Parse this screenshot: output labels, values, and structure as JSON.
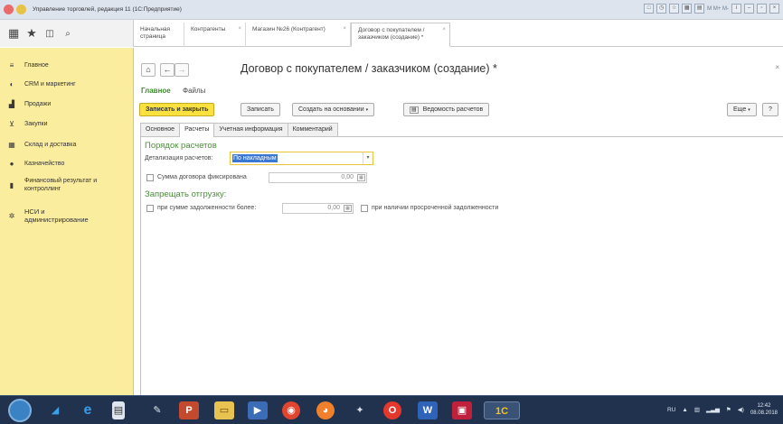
{
  "window": {
    "title": "Управление торговлей, редакция 11 (1С:Предприятие)",
    "right_text": "M  M+  M-"
  },
  "top_tabs": [
    {
      "label": "Начальная страница"
    },
    {
      "label": "Контрагенты"
    },
    {
      "label": "Магазин №26 (Контрагент)"
    },
    {
      "label1": "Договор с покупателем /",
      "label2": "заказчиком (создание) *"
    }
  ],
  "sidebar": {
    "items": [
      {
        "label": "Главное"
      },
      {
        "label": "CRM и маркетинг"
      },
      {
        "label": "Продажи"
      },
      {
        "label": "Закупки"
      },
      {
        "label": "Склад и доставка"
      },
      {
        "label": "Казначейство"
      },
      {
        "label1": "Финансовый результат и",
        "label2": "контроллинг"
      },
      {
        "label1": "НСИ и",
        "label2": "администрирование"
      }
    ]
  },
  "form": {
    "title": "Договор с покупателем / заказчиком (создание) *",
    "section_main": "Главное",
    "section_files": "Файлы",
    "buttons": {
      "save_close": "Записать и закрыть",
      "save": "Записать",
      "create_based": "Создать на основании",
      "statement": "Ведомость расчетов",
      "more": "Еще",
      "help": "?"
    },
    "tabs": [
      "Основное",
      "Расчеты",
      "Учетная информация",
      "Комментарий"
    ],
    "group_settlement": "Порядок расчетов",
    "detail_label": "Детализация расчетов:",
    "detail_value": "По накладным",
    "fixed_sum_label": "Сумма договора фиксирована",
    "fixed_sum_value": "0,00",
    "group_forbid": "Запрещать отгрузку:",
    "debt_label": "при сумме задолженности более:",
    "debt_value": "0,00",
    "overdue_label": "при наличии просроченной задолженности"
  },
  "taskbar": {
    "lang": "RU",
    "time": "12:42",
    "date": "08.08.2018"
  }
}
